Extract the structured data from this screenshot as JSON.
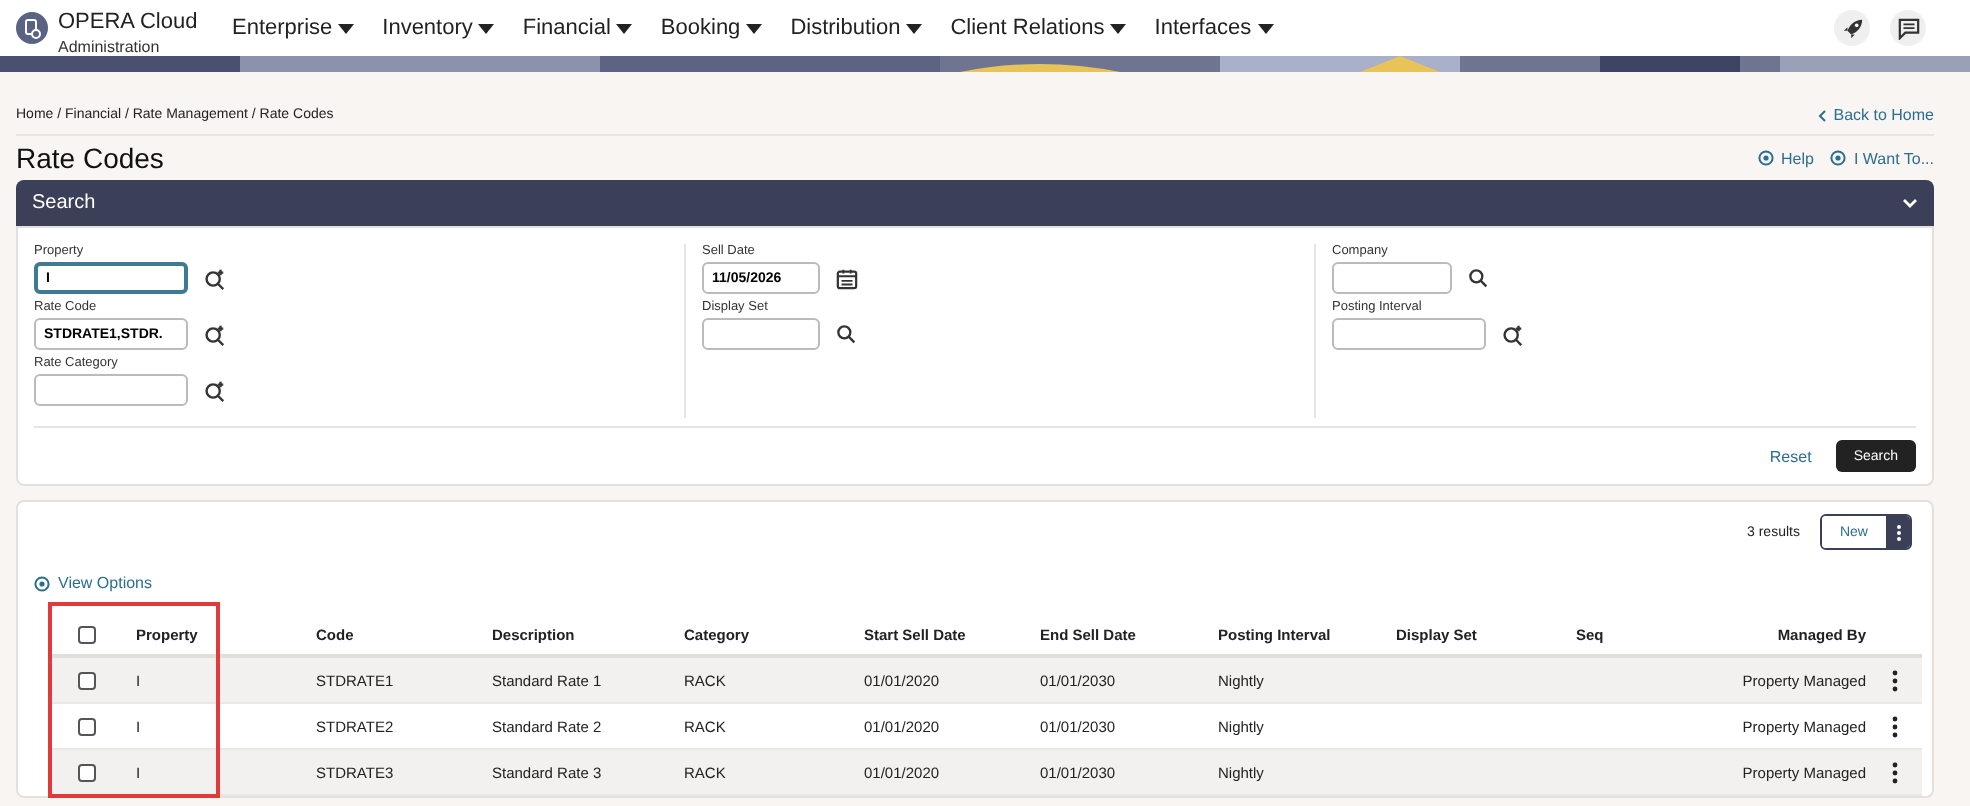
{
  "app": {
    "name": "OPERA Cloud",
    "subtitle": "Administration"
  },
  "nav": [
    {
      "label": "Enterprise"
    },
    {
      "label": "Inventory"
    },
    {
      "label": "Financial"
    },
    {
      "label": "Booking"
    },
    {
      "label": "Distribution"
    },
    {
      "label": "Client Relations"
    },
    {
      "label": "Interfaces"
    }
  ],
  "breadcrumb": "Home / Financial / Rate Management / Rate Codes",
  "back_link": "Back to Home",
  "page_title": "Rate Codes",
  "page_actions": [
    "Help",
    "I Want To..."
  ],
  "search_panel": {
    "title": "Search",
    "columns": [
      [
        {
          "label": "Property",
          "value": "I",
          "kind": "lookup",
          "focused": true
        },
        {
          "label": "Rate Code",
          "value": "STDRATE1,STDR.",
          "kind": "lookup",
          "focused": false
        },
        {
          "label": "Rate Category",
          "kind": "lookup",
          "focused": false
        }
      ],
      [
        {
          "label": "Sell Date",
          "value": "11/05/2026",
          "kind": "date",
          "focused": false
        },
        {
          "label": "Display Set",
          "kind": "search",
          "focused": false
        }
      ],
      [
        {
          "label": "Company",
          "kind": "search",
          "focused": false
        },
        {
          "label": "Posting Interval",
          "kind": "lookup",
          "focused": false
        }
      ]
    ],
    "reset": "Reset",
    "search_button": "Search"
  },
  "results": {
    "count": "3 results",
    "new_button": "New",
    "view_options": "View Options",
    "columns": [
      "Property",
      "Code",
      "Description",
      "Category",
      "Start Sell Date",
      "End Sell Date",
      "Posting Interval",
      "Display Set",
      "Seq",
      "Managed By"
    ],
    "header_checked": false,
    "rows": [
      {
        "checked": false,
        "cells": [
          "I",
          "STDRATE1",
          "Standard Rate 1",
          "RACK",
          "01/01/2020",
          "01/01/2030",
          "Nightly",
          "",
          "",
          "Property Managed"
        ]
      },
      {
        "checked": false,
        "cells": [
          "I",
          "STDRATE2",
          "Standard Rate 2",
          "RACK",
          "01/01/2020",
          "01/01/2030",
          "Nightly",
          "",
          "",
          "Property Managed"
        ]
      },
      {
        "checked": false,
        "cells": [
          "I",
          "STDRATE3",
          "Standard Rate 3",
          "RACK",
          "01/01/2020",
          "01/01/2030",
          "Nightly",
          "",
          "",
          "Property Managed"
        ]
      }
    ]
  }
}
